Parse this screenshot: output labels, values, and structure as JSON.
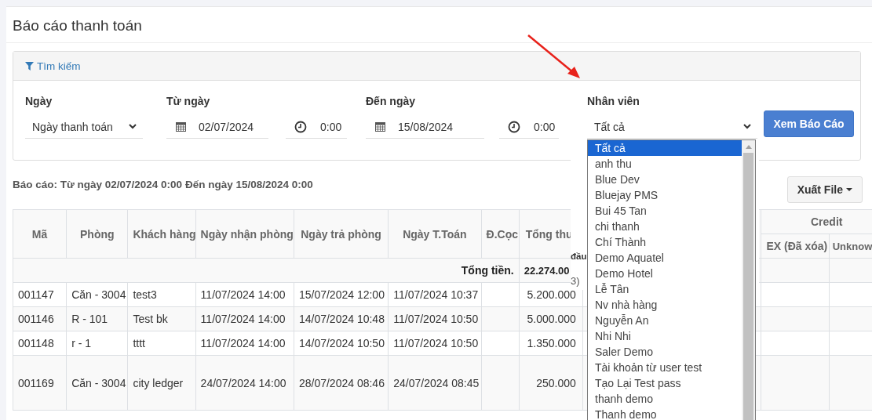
{
  "page": {
    "title": "Báo cáo thanh toán"
  },
  "search_panel": {
    "title": "Tìm kiếm",
    "date_type": {
      "label": "Ngày",
      "value": "Ngày thanh toán"
    },
    "from": {
      "label": "Từ ngày",
      "date": "02/07/2024",
      "time": "0:00"
    },
    "to": {
      "label": "Đến ngày",
      "date": "15/08/2024",
      "time": "0:00"
    },
    "staff": {
      "label": "Nhân viên",
      "value": "Tất cả",
      "expanded": true,
      "options": [
        {
          "label": "Tất cả",
          "selected": true
        },
        {
          "label": "anh thu",
          "selected": false
        },
        {
          "label": "Blue Dev",
          "selected": false
        },
        {
          "label": "Bluejay PMS",
          "selected": false
        },
        {
          "label": "Bui 45 Tan",
          "selected": false
        },
        {
          "label": "chi thanh",
          "selected": false
        },
        {
          "label": "Chí Thành",
          "selected": false
        },
        {
          "label": "Demo Aquatel",
          "selected": false
        },
        {
          "label": "Demo Hotel",
          "selected": false
        },
        {
          "label": "Lễ Tân",
          "selected": false
        },
        {
          "label": "Nv nhà hàng",
          "selected": false
        },
        {
          "label": "Nguyễn An",
          "selected": false
        },
        {
          "label": "Nhi Nhi",
          "selected": false
        },
        {
          "label": "Saler Demo",
          "selected": false
        },
        {
          "label": "Tài khoản từ user test",
          "selected": false
        },
        {
          "label": "Tạo Lại Test pass",
          "selected": false
        },
        {
          "label": "thanh demo",
          "selected": false
        },
        {
          "label": "Thanh demo",
          "selected": false
        }
      ]
    },
    "submit": "Xem Báo Cáo"
  },
  "report_summary": "Báo cáo: Từ ngày 02/07/2024 0:00 Đến ngày 15/08/2024 0:00",
  "export_button": "Xuất File",
  "hidden_fragments": [
    "đầu",
    "3)"
  ],
  "table": {
    "columns": [
      "Mã",
      "Phòng",
      "Khách hàng",
      "Ngày nhận phòng",
      "Ngày trả phòng",
      "Ngày T.Toán",
      "Đ.Cọc",
      "Tổng thu"
    ],
    "group_header": "Credit",
    "group_columns": [
      "EX (Đã xóa)",
      "Unknow"
    ],
    "total": {
      "label": "Tổng tiền.",
      "value": "22.274.00"
    },
    "rows": [
      {
        "cells": [
          "001147",
          "Căn - 3004",
          "test3",
          "11/07/2024 14:00",
          "15/07/2024 12:00",
          "11/07/2024 10:37",
          "",
          "5.200.000"
        ]
      },
      {
        "cells": [
          "001146",
          "R - 101",
          "Test bk",
          "11/07/2024 14:00",
          "14/07/2024 10:48",
          "11/07/2024 10:50",
          "",
          "5.000.000"
        ]
      },
      {
        "cells": [
          "001148",
          "r - 1",
          "tttt",
          "11/07/2024 14:00",
          "14/07/2024 10:50",
          "11/07/2024 10:50",
          "",
          "1.350.000"
        ]
      },
      {
        "cells": [
          "001169",
          "Căn - 3004",
          "city ledger",
          "24/07/2024 14:00",
          "28/07/2024 08:46",
          "24/07/2024 08:45",
          "",
          "250.000"
        ]
      }
    ]
  }
}
